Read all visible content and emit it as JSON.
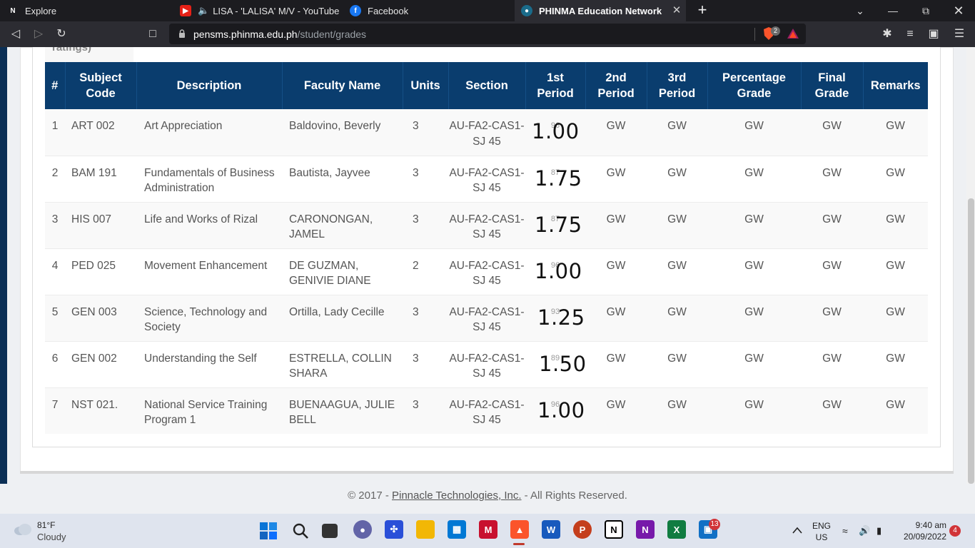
{
  "browser": {
    "tabs": [
      {
        "label": "Explore",
        "icon": "notion-icon"
      },
      {
        "label": "LISA - 'LALISA' M/V - YouTube",
        "icon": "youtube-icon"
      },
      {
        "label": "Facebook",
        "icon": "facebook-icon"
      },
      {
        "label": "PHINMA Education Network",
        "icon": "phinma-icon",
        "active": true
      }
    ],
    "url_host": "pensms.phinma.edu.ph",
    "url_path": "/student/grades",
    "shield_badge": "2"
  },
  "grades": {
    "partial_tab_label": "ratings)",
    "columns": [
      "#",
      "Subject Code",
      "Description",
      "Faculty Name",
      "Units",
      "Section",
      "1st Period",
      "2nd Period",
      "3rd Period",
      "Percentage Grade",
      "Final Grade",
      "Remarks"
    ],
    "rows": [
      {
        "num": "1",
        "code": "ART 002",
        "desc": "Art Appreciation",
        "faculty": "Baldovino, Beverly",
        "units": "3",
        "section": "AU-FA2-CAS1-SJ 45",
        "p1_faint": "96",
        "p1_overlay": "1.00",
        "p2": "GW",
        "p3": "GW",
        "pct": "GW",
        "final": "GW",
        "remarks": "GW"
      },
      {
        "num": "2",
        "code": "BAM 191",
        "desc": "Fundamentals of Business Administration",
        "faculty": "Bautista, Jayvee",
        "units": "3",
        "section": "AU-FA2-CAS1-SJ 45",
        "p1_faint": "87",
        "p1_overlay": "1.75",
        "p2": "GW",
        "p3": "GW",
        "pct": "GW",
        "final": "GW",
        "remarks": "GW"
      },
      {
        "num": "3",
        "code": "HIS 007",
        "desc": "Life and Works of Rizal",
        "faculty": "CARONONGAN, JAMEL",
        "units": "3",
        "section": "AU-FA2-CAS1-SJ 45",
        "p1_faint": "87",
        "p1_overlay": "1.75",
        "p2": "GW",
        "p3": "GW",
        "pct": "GW",
        "final": "GW",
        "remarks": "GW"
      },
      {
        "num": "4",
        "code": "PED 025",
        "desc": "Movement Enhancement",
        "faculty": "DE GUZMAN, GENIVIE DIANE",
        "units": "2",
        "section": "AU-FA2-CAS1-SJ 45",
        "p1_faint": "96",
        "p1_overlay": "1.00",
        "p2": "GW",
        "p3": "GW",
        "pct": "GW",
        "final": "GW",
        "remarks": "GW"
      },
      {
        "num": "5",
        "code": "GEN 003",
        "desc": "Science, Technology and Society",
        "faculty": "Ortilla, Lady Cecille",
        "units": "3",
        "section": "AU-FA2-CAS1-SJ 45",
        "p1_faint": "93",
        "p1_overlay": "1.25",
        "p2": "GW",
        "p3": "GW",
        "pct": "GW",
        "final": "GW",
        "remarks": "GW"
      },
      {
        "num": "6",
        "code": "GEN 002",
        "desc": "Understanding the Self",
        "faculty": "ESTRELLA, COLLIN SHARA",
        "units": "3",
        "section": "AU-FA2-CAS1-SJ 45",
        "p1_faint": "89",
        "p1_overlay": "1.50",
        "p2": "GW",
        "p3": "GW",
        "pct": "GW",
        "final": "GW",
        "remarks": "GW"
      },
      {
        "num": "7",
        "code": "NST 021.",
        "desc": "National Service Training Program 1",
        "faculty": "BUENAAGUA, JULIE BELL",
        "units": "3",
        "section": "AU-FA2-CAS1-SJ 45",
        "p1_faint": "96",
        "p1_overlay": "1.00",
        "p2": "GW",
        "p3": "GW",
        "pct": "GW",
        "final": "GW",
        "remarks": "GW"
      }
    ]
  },
  "footer": {
    "prefix": "© 2017 - ",
    "link": "Pinnacle Technologies, Inc.",
    "suffix": " - All Rights Reserved."
  },
  "taskbar": {
    "weather_temp": "81°F",
    "weather_desc": "Cloudy",
    "teams_badge": "13",
    "lang_top": "ENG",
    "lang_bottom": "US",
    "time": "9:40 am",
    "date": "20/09/2022",
    "notif_count": "4"
  },
  "colors": {
    "header_bg": "#0a3d6e",
    "accent_red": "#d13438"
  }
}
